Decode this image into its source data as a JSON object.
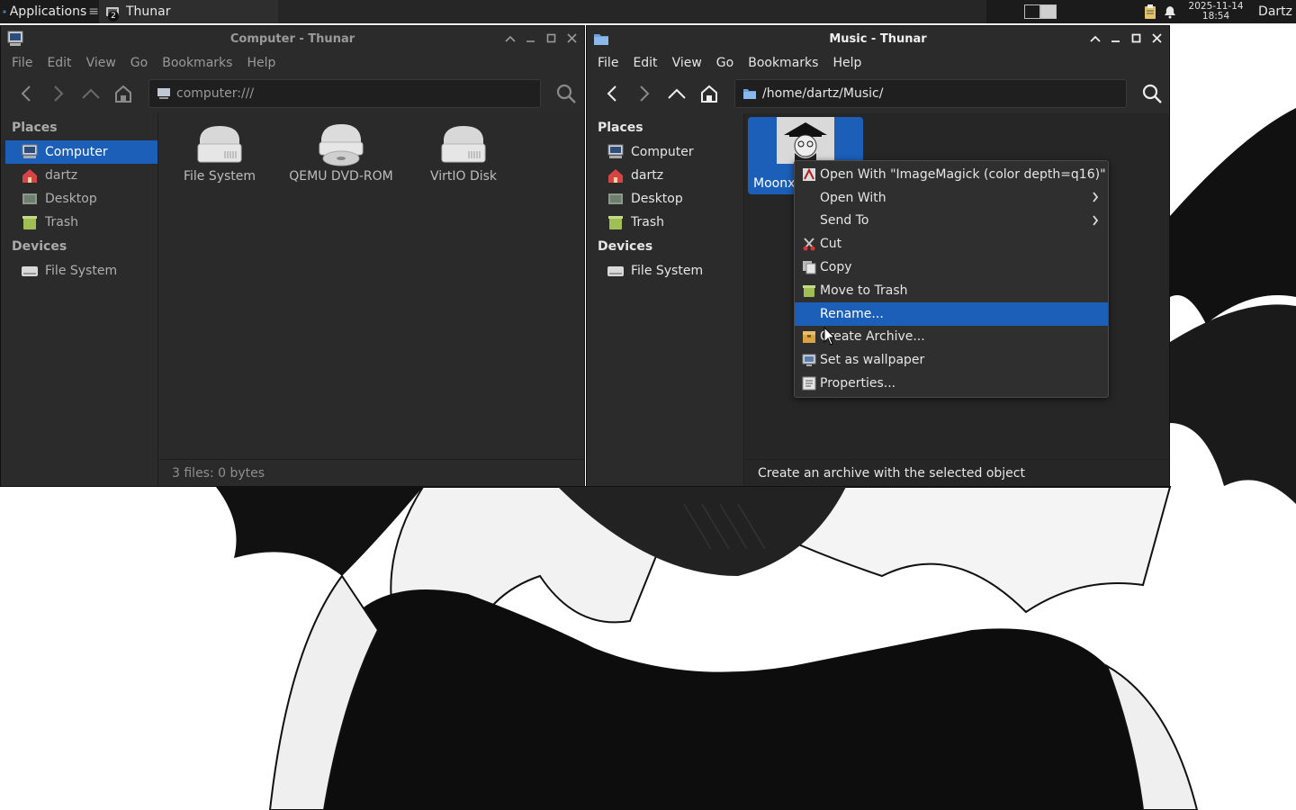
{
  "panel": {
    "applications_label": "Applications",
    "task_label": "Thunar",
    "task_badge": "2",
    "clock_date": "2025-11-14",
    "clock_time": "18:54",
    "user": "Dartz"
  },
  "left_window": {
    "title": "Computer - Thunar",
    "menu": [
      "File",
      "Edit",
      "View",
      "Go",
      "Bookmarks",
      "Help"
    ],
    "location": "computer:///",
    "places_header": "Places",
    "places": [
      "Computer",
      "dartz",
      "Desktop",
      "Trash"
    ],
    "devices_header": "Devices",
    "devices": [
      "File System"
    ],
    "files": [
      "File System",
      "QEMU DVD-ROM",
      "VirtIO Disk"
    ],
    "status": "3 files: 0 bytes"
  },
  "right_window": {
    "title": "Music - Thunar",
    "menu": [
      "File",
      "Edit",
      "View",
      "Go",
      "Bookmarks",
      "Help"
    ],
    "location": "/home/dartz/Music/",
    "places_header": "Places",
    "places": [
      "Computer",
      "dartz",
      "Desktop",
      "Trash"
    ],
    "devices_header": "Devices",
    "devices": [
      "File System"
    ],
    "selected_file": "Moonx-",
    "status": "Create an archive with the selected object"
  },
  "context_menu": {
    "items": [
      "Open With \"ImageMagick (color depth=q16)\"",
      "Open With",
      "Send To",
      "Cut",
      "Copy",
      "Move to Trash",
      "Rename...",
      "Create Archive...",
      "Set as wallpaper",
      "Properties..."
    ],
    "highlighted_index": 6
  },
  "colors": {
    "accent": "#1c5fb8",
    "window_bg": "#2b2b2b",
    "panel_bg": "#1b1b1b"
  }
}
